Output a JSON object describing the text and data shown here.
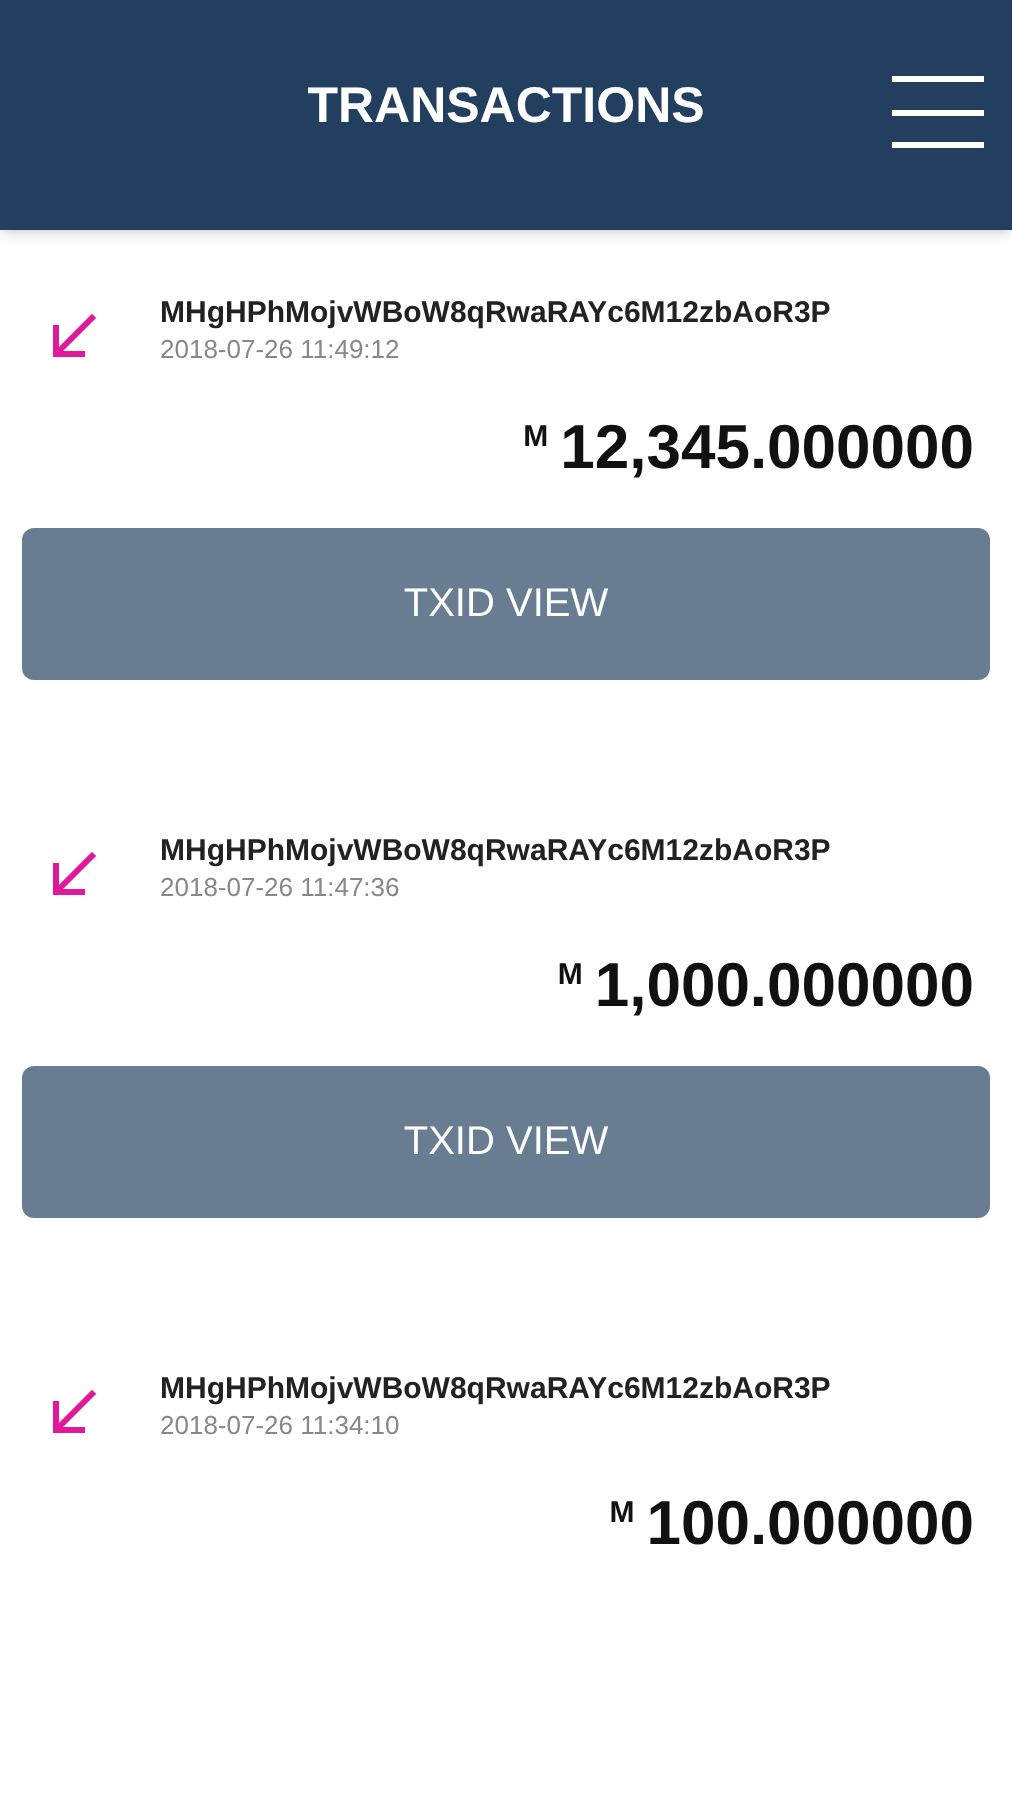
{
  "header": {
    "title": "TRANSACTIONS"
  },
  "transactions": [
    {
      "kind": "received",
      "address": "MHgHPhMojvWBoW8qRwaRAYc6M12zbAoR3P",
      "time": "2018-07-26 11:49:12",
      "currency": "M",
      "amount": "12,345.000000",
      "button": "TXID VIEW"
    },
    {
      "kind": "received",
      "address": "MHgHPhMojvWBoW8qRwaRAYc6M12zbAoR3P",
      "time": "2018-07-26 11:47:36",
      "currency": "M",
      "amount": "1,000.000000",
      "button": "TXID VIEW"
    },
    {
      "kind": "received",
      "address": "MHgHPhMojvWBoW8qRwaRAYc6M12zbAoR3P",
      "time": "2018-07-26 11:34:10",
      "currency": "M",
      "amount": "100.000000"
    }
  ]
}
